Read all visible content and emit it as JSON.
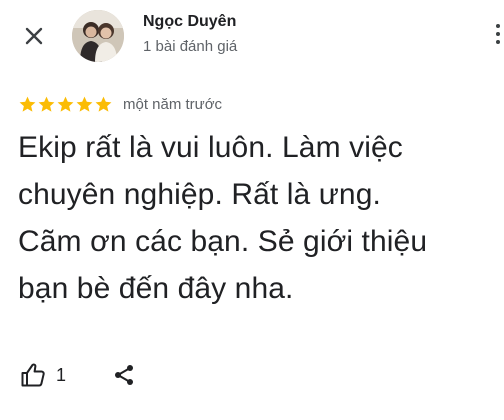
{
  "header": {
    "close_icon": "close-icon",
    "author_name": "Ngọc Duyên",
    "review_count": "1 bài đánh giá",
    "more_icon": "more-vert-icon"
  },
  "review": {
    "rating": 5,
    "rating_max": 5,
    "star_color": "#fbbc04",
    "time_ago": "một năm trước",
    "text_lines": [
      "Ekip rất là vui luôn. Làm việc",
      "chuyên nghiệp. Rất là ưng.",
      "Cãm ơn các bạn. Sẻ giới thiệu",
      "bạn bè đến đây nha."
    ]
  },
  "actions": {
    "like_icon": "thumb-up-icon",
    "like_count": "1",
    "share_icon": "share-icon"
  }
}
